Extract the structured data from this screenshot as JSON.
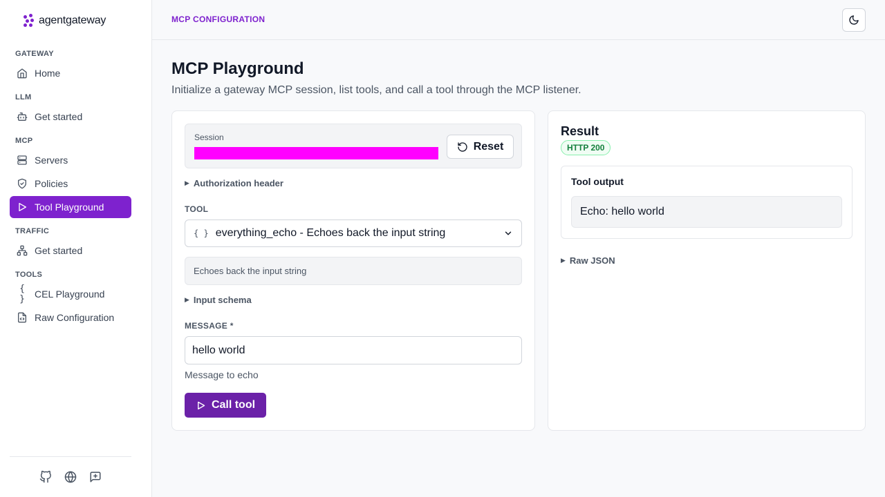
{
  "app": {
    "logo_text": "agentgateway"
  },
  "sidebar": {
    "sections": [
      {
        "label": "GATEWAY",
        "items": [
          {
            "label": "Home",
            "icon": "home-icon"
          }
        ]
      },
      {
        "label": "LLM",
        "items": [
          {
            "label": "Get started",
            "icon": "bot-icon"
          }
        ]
      },
      {
        "label": "MCP",
        "items": [
          {
            "label": "Servers",
            "icon": "server-icon"
          },
          {
            "label": "Policies",
            "icon": "shield-icon"
          },
          {
            "label": "Tool Playground",
            "icon": "play-icon",
            "active": true
          }
        ]
      },
      {
        "label": "TRAFFIC",
        "items": [
          {
            "label": "Get started",
            "icon": "network-icon"
          }
        ]
      },
      {
        "label": "TOOLS",
        "items": [
          {
            "label": "CEL Playground",
            "icon": "braces-icon",
            "glyph": "{ }"
          },
          {
            "label": "Raw Configuration",
            "icon": "file-code-icon"
          }
        ]
      }
    ],
    "footer_icons": [
      "github-icon",
      "globe-icon",
      "feedback-icon"
    ]
  },
  "header": {
    "breadcrumb": "MCP CONFIGURATION",
    "theme_icon": "moon-icon"
  },
  "page": {
    "title": "MCP Playground",
    "subtitle": "Initialize a gateway MCP session, list tools, and call a tool through the MCP listener."
  },
  "session": {
    "label": "Session",
    "reset_label": "Reset"
  },
  "auth": {
    "label": "Authorization header"
  },
  "tool": {
    "label": "TOOL",
    "selected": "everything_echo - Echoes back the input string",
    "icon_glyph": "{ }",
    "description": "Echoes back the input string"
  },
  "schema": {
    "label": "Input schema"
  },
  "message": {
    "label": "MESSAGE *",
    "value": "hello world",
    "hint": "Message to echo"
  },
  "call": {
    "label": "Call tool"
  },
  "result": {
    "title": "Result",
    "status": "HTTP 200",
    "output_title": "Tool output",
    "output_text": "Echo: hello world",
    "raw_label": "Raw JSON"
  },
  "colors": {
    "accent": "#7e22ce",
    "accent_dark": "#6b21a8",
    "success": "#15803d",
    "session_mask": "#ff00ff"
  }
}
